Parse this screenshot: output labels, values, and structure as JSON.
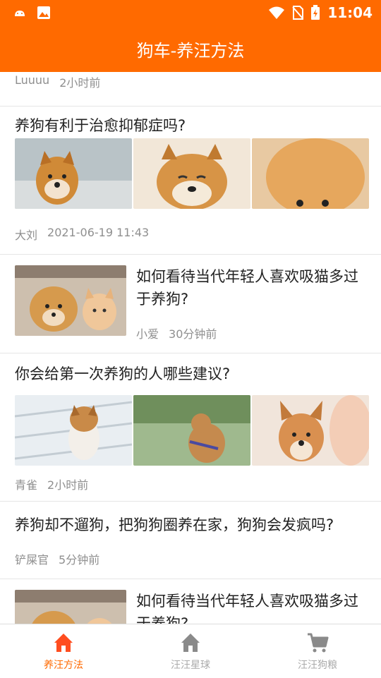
{
  "status": {
    "time": "11:04",
    "icons": [
      "android-icon",
      "image-icon",
      "wifi-icon",
      "no-sim-icon",
      "battery-charging-icon"
    ]
  },
  "appbar": {
    "title": "狗车-养汪方法"
  },
  "articles": [
    {
      "author": "Luuuu",
      "time": "2小时前"
    },
    {
      "title": "养狗有利于治愈抑郁症吗?",
      "author": "大刘",
      "time": "2021-06-19 11:43"
    },
    {
      "title": "如何看待当代年轻人喜欢吸猫多过于养狗?",
      "author": "小爱",
      "time": "30分钟前"
    },
    {
      "title": "你会给第一次养狗的人哪些建议?",
      "author": "青雀",
      "time": "2小时前"
    },
    {
      "title": "养狗却不遛狗，把狗狗圈养在家，狗狗会发疯吗?",
      "author": "铲屎官",
      "time": "5分钟前"
    },
    {
      "title": "如何看待当代年轻人喜欢吸猫多过于养狗?"
    }
  ],
  "tabs": [
    {
      "label": "养汪方法",
      "icon": "home-icon",
      "active": true
    },
    {
      "label": "汪汪星球",
      "icon": "home-icon",
      "active": false
    },
    {
      "label": "汪汪狗粮",
      "icon": "cart-icon",
      "active": false
    }
  ],
  "colors": {
    "accent": "#ff6a00",
    "tab_active": "#ff6a00",
    "tab_inactive": "#aaaaaa",
    "meta": "#8f8f8f"
  }
}
